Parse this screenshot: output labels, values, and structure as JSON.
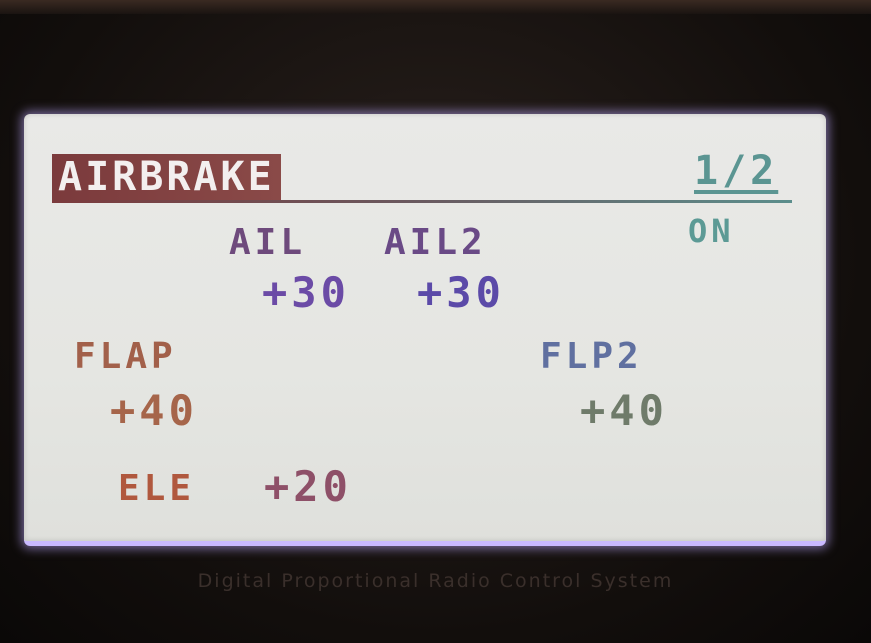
{
  "screen": {
    "title": "AIRBRAKE",
    "page_indicator": "1/2",
    "status": "ON"
  },
  "channels": {
    "ail": {
      "label": "AIL",
      "value": "+30"
    },
    "ail2": {
      "label": "AIL2",
      "value": "+30"
    },
    "flap": {
      "label": "FLAP",
      "value": "+40"
    },
    "flp2": {
      "label": "FLP2",
      "value": "+40"
    },
    "ele": {
      "label": "ELE",
      "value": "+20"
    }
  },
  "device": {
    "bottom_text": "Digital Proportional Radio Control System"
  },
  "colors": {
    "title_bar": "#7b3a3c",
    "status": "#5c9a95",
    "lcd_background": "#e6e7e3",
    "backlight_glow": "#c9b9ff"
  }
}
